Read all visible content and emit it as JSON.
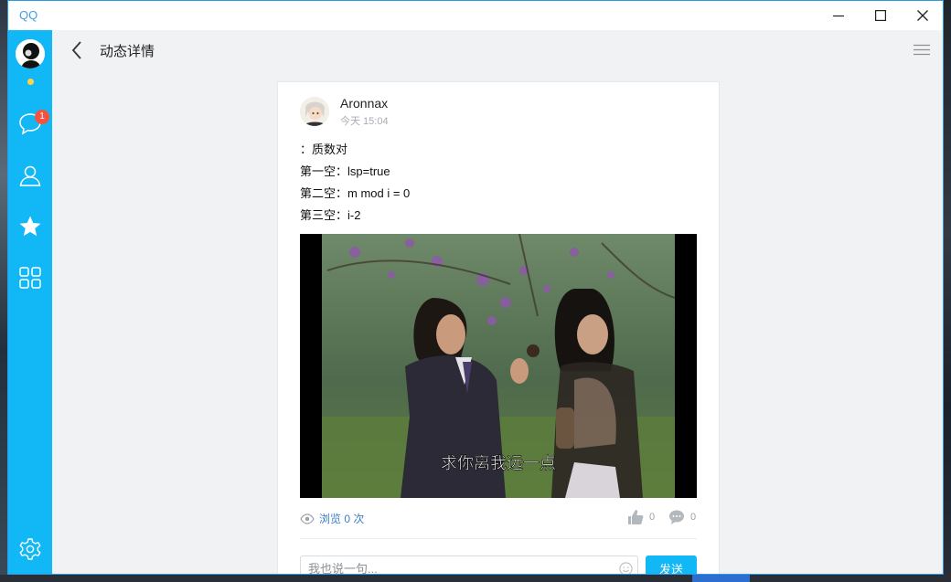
{
  "app": {
    "title": "QQ"
  },
  "window_controls": {
    "minimize": "minimize-icon",
    "maximize": "maximize-icon",
    "close": "close-icon"
  },
  "sidebar": {
    "accent": "#12b7f5",
    "status_color": "#ffd447",
    "items": [
      {
        "icon": "chat-bubble-icon",
        "badge": "1"
      },
      {
        "icon": "contacts-icon"
      },
      {
        "icon": "star-icon"
      },
      {
        "icon": "apps-grid-icon"
      },
      {
        "icon": "settings-gear-icon"
      }
    ]
  },
  "header": {
    "title": "动态详情",
    "back_icon": "chevron-left-icon",
    "menu_icon": "hamburger-menu-icon"
  },
  "post": {
    "author": "Aronnax",
    "time": "今天 15:04",
    "lines": [
      "：质数对",
      "第一空：lsp=true",
      "第二空：m mod i = 0",
      "第三空：i-2"
    ],
    "image": {
      "caption": "求你离我远一点"
    },
    "views_label": "浏览 0 次",
    "likes": "0",
    "comments": "0"
  },
  "comment_box": {
    "placeholder": "我也说一句...",
    "value": "",
    "send_label": "发送"
  }
}
